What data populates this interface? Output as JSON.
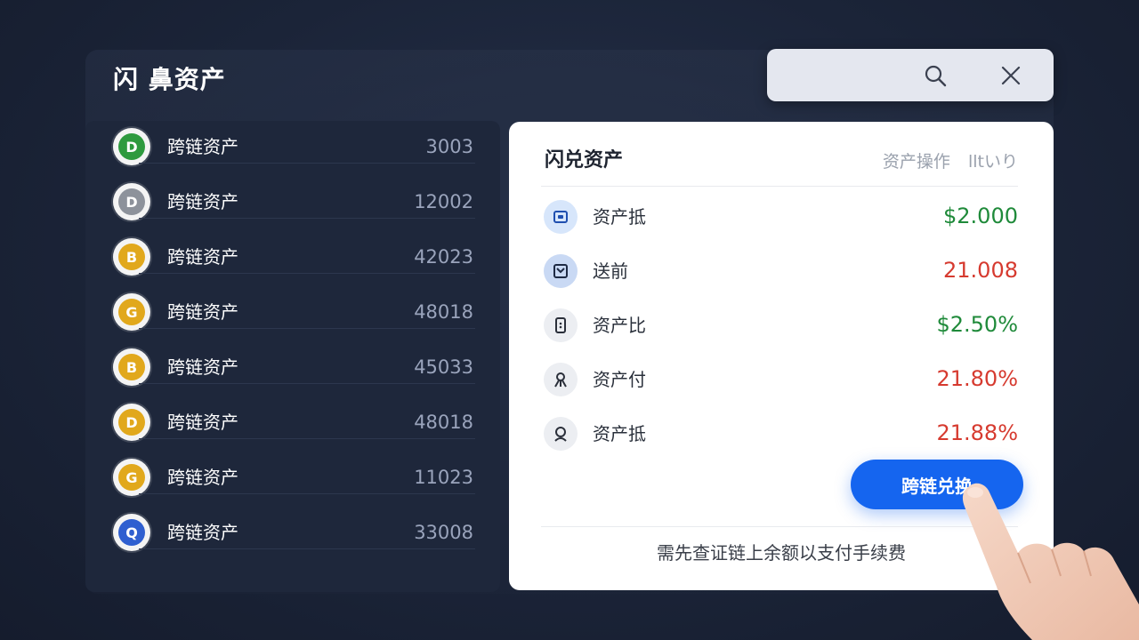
{
  "header": {
    "title": "闪 鼻资产"
  },
  "search": {
    "search_icon": "search-icon",
    "close_icon": "close-icon"
  },
  "asset_list": {
    "items": [
      {
        "name": "跨链资产",
        "amount": "3003",
        "coin_icon": "green-coin-icon",
        "coin_color": "#2e9a3e",
        "glyph": "D"
      },
      {
        "name": "跨链资产",
        "amount": "12002",
        "coin_icon": "silver-coin-icon",
        "coin_color": "#8d929b",
        "glyph": "D"
      },
      {
        "name": "跨链资产",
        "amount": "42023",
        "coin_icon": "gold-coin-icon",
        "coin_color": "#e1a81c",
        "glyph": "B"
      },
      {
        "name": "跨链资产",
        "amount": "48018",
        "coin_icon": "gold-coin-icon",
        "coin_color": "#e1a81c",
        "glyph": "G"
      },
      {
        "name": "跨链资产",
        "amount": "45033",
        "coin_icon": "white-gold-coin-icon",
        "coin_color": "#e1a81c",
        "glyph": "B"
      },
      {
        "name": "跨链资产",
        "amount": "48018",
        "coin_icon": "gold-coin-icon",
        "coin_color": "#e1a81c",
        "glyph": "D"
      },
      {
        "name": "跨链资产",
        "amount": "11023",
        "coin_icon": "gold-coin-icon",
        "coin_color": "#e1a81c",
        "glyph": "G"
      },
      {
        "name": "跨链资产",
        "amount": "33008",
        "coin_icon": "blue-coin-icon",
        "coin_color": "#2f5fd0",
        "glyph": "Q"
      }
    ]
  },
  "detail_card": {
    "title": "闪兑资产",
    "action_1": "资产操作",
    "action_2": "lltいり",
    "rows": [
      {
        "icon": "wallet-icon",
        "label": "资产抵",
        "value": "$2.000",
        "value_color": "#1f8a3a"
      },
      {
        "icon": "clipboard-icon",
        "label": "送前",
        "value": "21.008",
        "value_color": "#d63a2f"
      },
      {
        "icon": "phone-icon",
        "label": "资产比",
        "value": "$2.50%",
        "value_color": "#1f8a3a"
      },
      {
        "icon": "node-icon",
        "label": "资产付",
        "value": "21.80%",
        "value_color": "#d63a2f"
      },
      {
        "icon": "person-icon",
        "label": "资产抵",
        "value": "21.88%",
        "value_color": "#d63a2f"
      }
    ],
    "button_label": "跨链兑换",
    "note": "需先查证链上余额以支付手续费"
  },
  "colors": {
    "accent": "#1565ef",
    "positive": "#1f8a3a",
    "negative": "#d63a2f"
  }
}
